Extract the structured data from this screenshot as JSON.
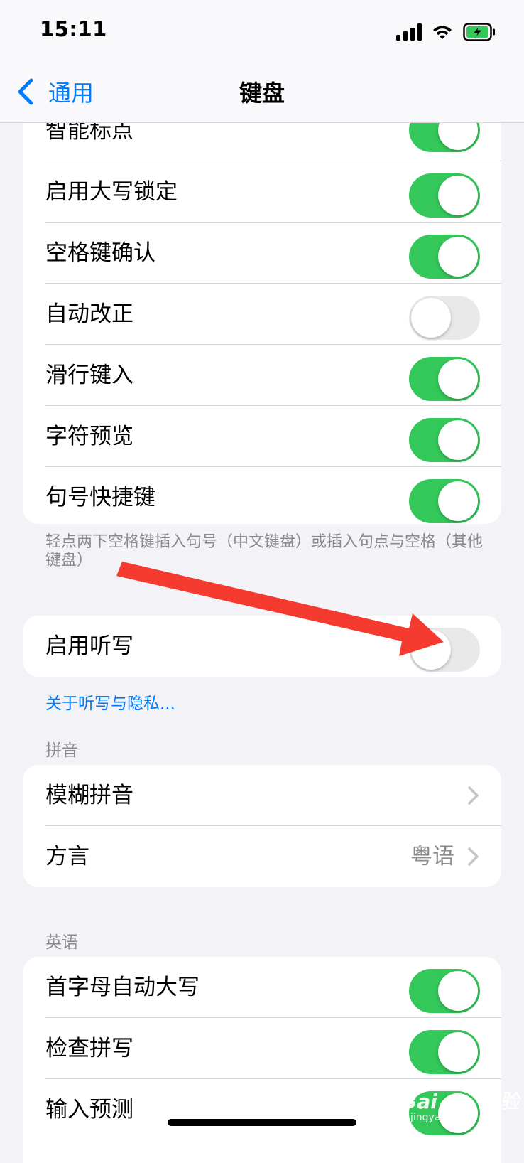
{
  "status": {
    "time": "15:11"
  },
  "nav": {
    "back_label": "通用",
    "title": "键盘"
  },
  "group1": {
    "rows": [
      {
        "label": "智能标点",
        "on": true
      },
      {
        "label": "启用大写锁定",
        "on": true
      },
      {
        "label": "空格键确认",
        "on": true
      },
      {
        "label": "自动改正",
        "on": false
      },
      {
        "label": "滑行键入",
        "on": true
      },
      {
        "label": "字符预览",
        "on": true
      },
      {
        "label": "句号快捷键",
        "on": true
      }
    ],
    "footnote": "轻点两下空格键插入句号（中文键盘）或插入句点与空格（其他键盘）"
  },
  "dictation": {
    "label": "启用听写",
    "on": false,
    "link": "关于听写与隐私..."
  },
  "pinyin": {
    "header": "拼音",
    "rows": [
      {
        "label": "模糊拼音",
        "value": ""
      },
      {
        "label": "方言",
        "value": "粤语"
      }
    ]
  },
  "english": {
    "header": "英语",
    "rows": [
      {
        "label": "首字母自动大写",
        "on": true
      },
      {
        "label": "检查拼写",
        "on": true
      },
      {
        "label": "输入预测",
        "on": true
      }
    ]
  },
  "watermark": {
    "brand": "Bai du 经验",
    "url": "jingyan.baidu.com"
  },
  "colors": {
    "accent": "#007aff",
    "toggle_on": "#34c759",
    "toggle_off": "#e9e9ea",
    "annotation_arrow": "#f53b2f"
  },
  "icons": [
    "signal-icon",
    "wifi-icon",
    "battery-charging-icon",
    "back-chevron-icon",
    "chevron-right-icon",
    "annotation-arrow"
  ]
}
